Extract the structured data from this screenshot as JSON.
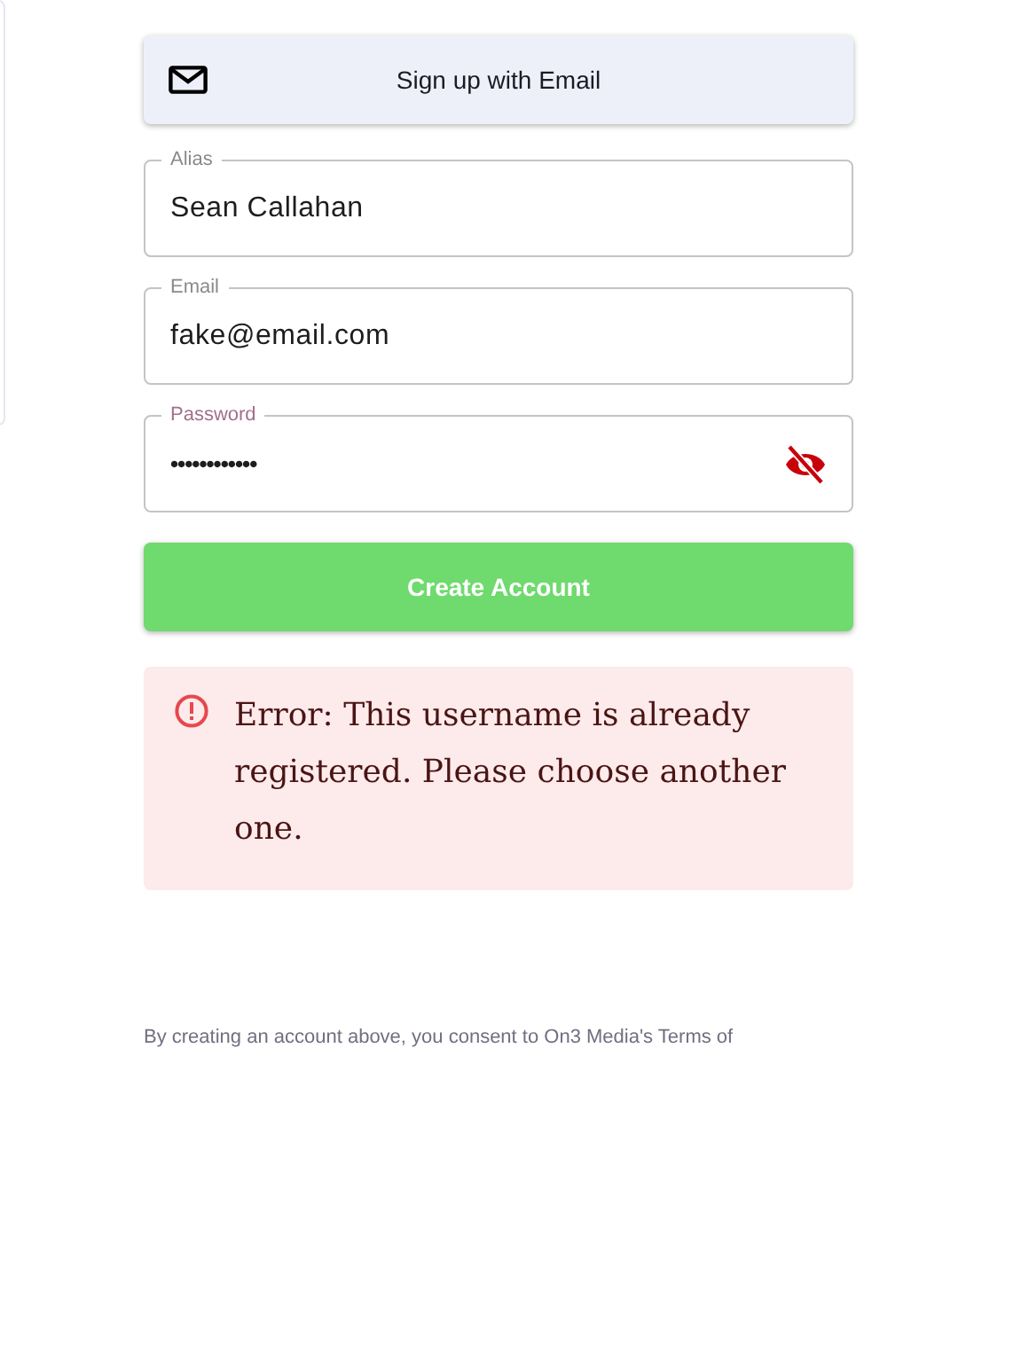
{
  "email_signup_button": {
    "label": "Sign up with Email"
  },
  "fields": [
    {
      "label": "Alias",
      "value": "Sean Callahan",
      "kind": "text"
    },
    {
      "label": "Email",
      "value": "fake@email.com",
      "kind": "text"
    },
    {
      "label": "Password",
      "value": "••••••••••••",
      "kind": "password",
      "password_visible": false
    }
  ],
  "create_button": {
    "label": "Create Account"
  },
  "error": {
    "message": "Error: This username is already registered. Please choose another one."
  },
  "consent_text": "By creating an account above, you consent to On3 Media's Terms of"
}
